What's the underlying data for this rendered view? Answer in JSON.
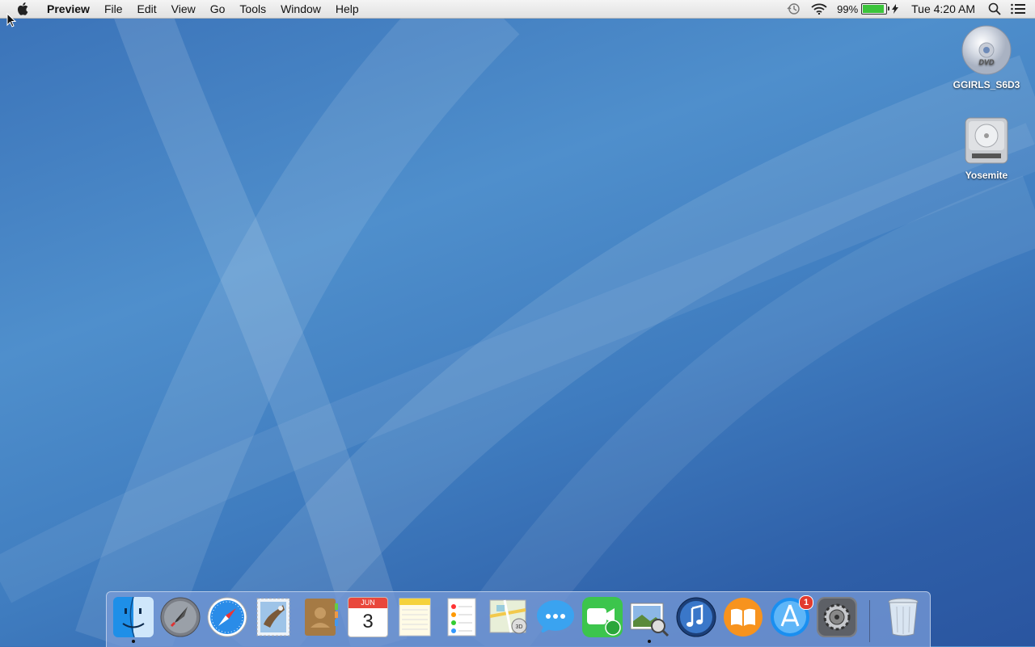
{
  "menubar": {
    "app_name": "Preview",
    "menus": [
      "File",
      "Edit",
      "View",
      "Go",
      "Tools",
      "Window",
      "Help"
    ],
    "battery_percent": "99%",
    "battery_level": 0.99,
    "clock": "Tue 4:20 AM"
  },
  "desktop": {
    "icons": [
      {
        "label": "GGIRLS_S6D3",
        "icon": "dvd-icon"
      },
      {
        "label": "Yosemite",
        "icon": "hard-drive-icon"
      }
    ]
  },
  "dock": {
    "items": [
      {
        "name": "finder",
        "running": true
      },
      {
        "name": "launchpad",
        "running": false
      },
      {
        "name": "safari",
        "running": false
      },
      {
        "name": "mail",
        "running": false
      },
      {
        "name": "contacts",
        "running": false
      },
      {
        "name": "calendar",
        "running": false,
        "month": "JUN",
        "day": "3"
      },
      {
        "name": "notes",
        "running": false
      },
      {
        "name": "reminders",
        "running": false
      },
      {
        "name": "maps",
        "running": false
      },
      {
        "name": "messages",
        "running": false
      },
      {
        "name": "facetime",
        "running": false
      },
      {
        "name": "preview",
        "running": true
      },
      {
        "name": "itunes",
        "running": false
      },
      {
        "name": "ibooks",
        "running": false
      },
      {
        "name": "app-store",
        "running": false,
        "badge": "1"
      },
      {
        "name": "system-preferences",
        "running": false
      },
      {
        "name": "trash",
        "running": false
      }
    ]
  },
  "colors": {
    "accent": "#3a72b8",
    "badge": "#e23b2e",
    "battery": "#3bc43b"
  }
}
